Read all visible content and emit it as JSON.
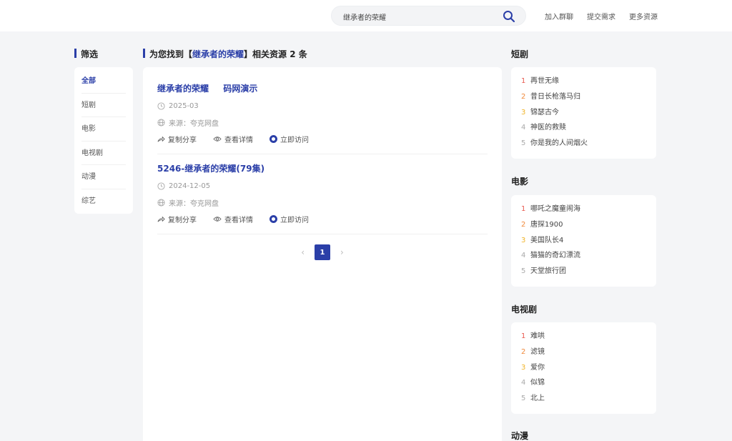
{
  "header": {
    "search_value": "继承者的荣耀",
    "links": [
      "加入群聊",
      "提交需求",
      "更多资源"
    ]
  },
  "filter": {
    "title": "筛选",
    "items": [
      "全部",
      "短剧",
      "电影",
      "电视剧",
      "动漫",
      "综艺"
    ]
  },
  "results": {
    "summary_prefix": "为您找到【",
    "keyword": "继承者的荣耀",
    "summary_suffix": "】相关资源 2 条",
    "items": [
      {
        "title": "继承者的荣耀 　 码网演示",
        "date": "2025-03",
        "source": "来源：夸克网盘"
      },
      {
        "title": "5246-继承者的荣耀(79集)",
        "date": "2024-12-05",
        "source": "来源：夸克网盘"
      }
    ],
    "actions": [
      "复制分享",
      "查看详情",
      "立即访问"
    ],
    "pager": {
      "prev": "‹",
      "current": "1",
      "next": "›"
    }
  },
  "rankings": [
    {
      "title": "短剧",
      "items": [
        "再世无缘",
        "昔日长枪落马归",
        "锦瑟古今",
        "神医的救赎",
        "你是我的人间烟火"
      ]
    },
    {
      "title": "电影",
      "items": [
        "哪吒之魔童闹海",
        "唐探1900",
        "美国队长4",
        "猫猫的奇幻漂流",
        "天堂旅行团"
      ]
    },
    {
      "title": "电视剧",
      "items": [
        "难哄",
        "滤镜",
        "爱你",
        "似锦",
        "北上"
      ]
    },
    {
      "title": "动漫",
      "items": []
    }
  ],
  "colors": {
    "accent": "#2b3fa8"
  }
}
